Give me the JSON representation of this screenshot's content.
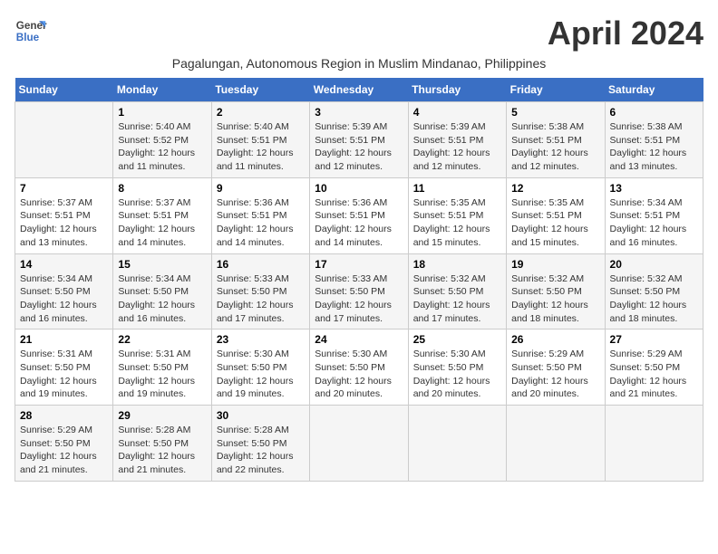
{
  "header": {
    "logo_line1": "General",
    "logo_line2": "Blue",
    "month_title": "April 2024",
    "subtitle": "Pagalungan, Autonomous Region in Muslim Mindanao, Philippines"
  },
  "days_of_week": [
    "Sunday",
    "Monday",
    "Tuesday",
    "Wednesday",
    "Thursday",
    "Friday",
    "Saturday"
  ],
  "weeks": [
    [
      {
        "day": "",
        "sunrise": "",
        "sunset": "",
        "daylight": ""
      },
      {
        "day": "1",
        "sunrise": "Sunrise: 5:40 AM",
        "sunset": "Sunset: 5:52 PM",
        "daylight": "Daylight: 12 hours and 11 minutes."
      },
      {
        "day": "2",
        "sunrise": "Sunrise: 5:40 AM",
        "sunset": "Sunset: 5:51 PM",
        "daylight": "Daylight: 12 hours and 11 minutes."
      },
      {
        "day": "3",
        "sunrise": "Sunrise: 5:39 AM",
        "sunset": "Sunset: 5:51 PM",
        "daylight": "Daylight: 12 hours and 12 minutes."
      },
      {
        "day": "4",
        "sunrise": "Sunrise: 5:39 AM",
        "sunset": "Sunset: 5:51 PM",
        "daylight": "Daylight: 12 hours and 12 minutes."
      },
      {
        "day": "5",
        "sunrise": "Sunrise: 5:38 AM",
        "sunset": "Sunset: 5:51 PM",
        "daylight": "Daylight: 12 hours and 12 minutes."
      },
      {
        "day": "6",
        "sunrise": "Sunrise: 5:38 AM",
        "sunset": "Sunset: 5:51 PM",
        "daylight": "Daylight: 12 hours and 13 minutes."
      }
    ],
    [
      {
        "day": "7",
        "sunrise": "Sunrise: 5:37 AM",
        "sunset": "Sunset: 5:51 PM",
        "daylight": "Daylight: 12 hours and 13 minutes."
      },
      {
        "day": "8",
        "sunrise": "Sunrise: 5:37 AM",
        "sunset": "Sunset: 5:51 PM",
        "daylight": "Daylight: 12 hours and 14 minutes."
      },
      {
        "day": "9",
        "sunrise": "Sunrise: 5:36 AM",
        "sunset": "Sunset: 5:51 PM",
        "daylight": "Daylight: 12 hours and 14 minutes."
      },
      {
        "day": "10",
        "sunrise": "Sunrise: 5:36 AM",
        "sunset": "Sunset: 5:51 PM",
        "daylight": "Daylight: 12 hours and 14 minutes."
      },
      {
        "day": "11",
        "sunrise": "Sunrise: 5:35 AM",
        "sunset": "Sunset: 5:51 PM",
        "daylight": "Daylight: 12 hours and 15 minutes."
      },
      {
        "day": "12",
        "sunrise": "Sunrise: 5:35 AM",
        "sunset": "Sunset: 5:51 PM",
        "daylight": "Daylight: 12 hours and 15 minutes."
      },
      {
        "day": "13",
        "sunrise": "Sunrise: 5:34 AM",
        "sunset": "Sunset: 5:51 PM",
        "daylight": "Daylight: 12 hours and 16 minutes."
      }
    ],
    [
      {
        "day": "14",
        "sunrise": "Sunrise: 5:34 AM",
        "sunset": "Sunset: 5:50 PM",
        "daylight": "Daylight: 12 hours and 16 minutes."
      },
      {
        "day": "15",
        "sunrise": "Sunrise: 5:34 AM",
        "sunset": "Sunset: 5:50 PM",
        "daylight": "Daylight: 12 hours and 16 minutes."
      },
      {
        "day": "16",
        "sunrise": "Sunrise: 5:33 AM",
        "sunset": "Sunset: 5:50 PM",
        "daylight": "Daylight: 12 hours and 17 minutes."
      },
      {
        "day": "17",
        "sunrise": "Sunrise: 5:33 AM",
        "sunset": "Sunset: 5:50 PM",
        "daylight": "Daylight: 12 hours and 17 minutes."
      },
      {
        "day": "18",
        "sunrise": "Sunrise: 5:32 AM",
        "sunset": "Sunset: 5:50 PM",
        "daylight": "Daylight: 12 hours and 17 minutes."
      },
      {
        "day": "19",
        "sunrise": "Sunrise: 5:32 AM",
        "sunset": "Sunset: 5:50 PM",
        "daylight": "Daylight: 12 hours and 18 minutes."
      },
      {
        "day": "20",
        "sunrise": "Sunrise: 5:32 AM",
        "sunset": "Sunset: 5:50 PM",
        "daylight": "Daylight: 12 hours and 18 minutes."
      }
    ],
    [
      {
        "day": "21",
        "sunrise": "Sunrise: 5:31 AM",
        "sunset": "Sunset: 5:50 PM",
        "daylight": "Daylight: 12 hours and 19 minutes."
      },
      {
        "day": "22",
        "sunrise": "Sunrise: 5:31 AM",
        "sunset": "Sunset: 5:50 PM",
        "daylight": "Daylight: 12 hours and 19 minutes."
      },
      {
        "day": "23",
        "sunrise": "Sunrise: 5:30 AM",
        "sunset": "Sunset: 5:50 PM",
        "daylight": "Daylight: 12 hours and 19 minutes."
      },
      {
        "day": "24",
        "sunrise": "Sunrise: 5:30 AM",
        "sunset": "Sunset: 5:50 PM",
        "daylight": "Daylight: 12 hours and 20 minutes."
      },
      {
        "day": "25",
        "sunrise": "Sunrise: 5:30 AM",
        "sunset": "Sunset: 5:50 PM",
        "daylight": "Daylight: 12 hours and 20 minutes."
      },
      {
        "day": "26",
        "sunrise": "Sunrise: 5:29 AM",
        "sunset": "Sunset: 5:50 PM",
        "daylight": "Daylight: 12 hours and 20 minutes."
      },
      {
        "day": "27",
        "sunrise": "Sunrise: 5:29 AM",
        "sunset": "Sunset: 5:50 PM",
        "daylight": "Daylight: 12 hours and 21 minutes."
      }
    ],
    [
      {
        "day": "28",
        "sunrise": "Sunrise: 5:29 AM",
        "sunset": "Sunset: 5:50 PM",
        "daylight": "Daylight: 12 hours and 21 minutes."
      },
      {
        "day": "29",
        "sunrise": "Sunrise: 5:28 AM",
        "sunset": "Sunset: 5:50 PM",
        "daylight": "Daylight: 12 hours and 21 minutes."
      },
      {
        "day": "30",
        "sunrise": "Sunrise: 5:28 AM",
        "sunset": "Sunset: 5:50 PM",
        "daylight": "Daylight: 12 hours and 22 minutes."
      },
      {
        "day": "",
        "sunrise": "",
        "sunset": "",
        "daylight": ""
      },
      {
        "day": "",
        "sunrise": "",
        "sunset": "",
        "daylight": ""
      },
      {
        "day": "",
        "sunrise": "",
        "sunset": "",
        "daylight": ""
      },
      {
        "day": "",
        "sunrise": "",
        "sunset": "",
        "daylight": ""
      }
    ]
  ]
}
